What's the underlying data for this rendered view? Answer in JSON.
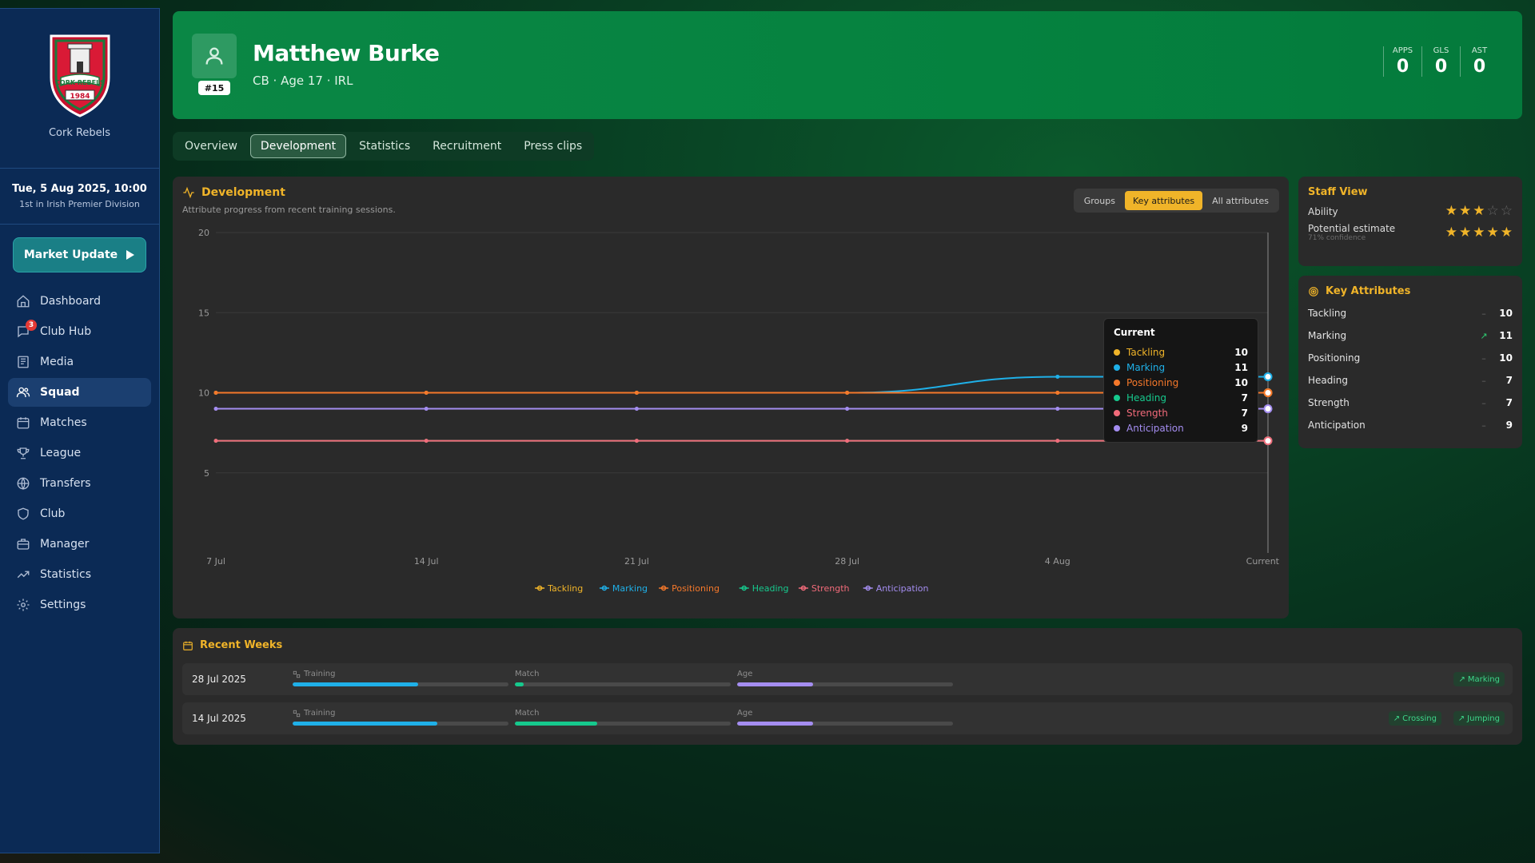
{
  "sidebar": {
    "club_name": "Cork Rebels",
    "crest_text": "CORK REBELS",
    "crest_year": "1984",
    "date": "Tue, 5 Aug 2025, 10:00",
    "league_position": "1st in Irish Premier Division",
    "market_button": "Market Update",
    "nav": [
      {
        "label": "Dashboard",
        "icon": "home-icon"
      },
      {
        "label": "Club Hub",
        "icon": "chat-icon",
        "badge": "3"
      },
      {
        "label": "Media",
        "icon": "newspaper-icon"
      },
      {
        "label": "Squad",
        "icon": "users-icon",
        "active": true
      },
      {
        "label": "Matches",
        "icon": "calendar-icon"
      },
      {
        "label": "League",
        "icon": "trophy-icon"
      },
      {
        "label": "Transfers",
        "icon": "globe-icon"
      },
      {
        "label": "Club",
        "icon": "shield-icon"
      },
      {
        "label": "Manager",
        "icon": "briefcase-icon"
      },
      {
        "label": "Statistics",
        "icon": "trend-icon"
      },
      {
        "label": "Settings",
        "icon": "gear-icon"
      }
    ]
  },
  "header": {
    "name": "Matthew Burke",
    "number": "#15",
    "meta": "CB · Age 17 · IRL",
    "stats": [
      {
        "label": "APPS",
        "value": "0"
      },
      {
        "label": "GLS",
        "value": "0"
      },
      {
        "label": "AST",
        "value": "0"
      }
    ]
  },
  "tabs": [
    "Overview",
    "Development",
    "Statistics",
    "Recruitment",
    "Press clips"
  ],
  "active_tab": "Development",
  "development": {
    "title": "Development",
    "subtitle": "Attribute progress from recent training sessions.",
    "toggle": [
      "Groups",
      "Key attributes",
      "All attributes"
    ],
    "toggle_active": "Key attributes",
    "tooltip": {
      "title": "Current",
      "rows": [
        {
          "name": "Tackling",
          "value": "10"
        },
        {
          "name": "Marking",
          "value": "11"
        },
        {
          "name": "Positioning",
          "value": "10"
        },
        {
          "name": "Heading",
          "value": "7"
        },
        {
          "name": "Strength",
          "value": "7"
        },
        {
          "name": "Anticipation",
          "value": "9"
        }
      ]
    }
  },
  "chart_data": {
    "type": "line",
    "categories": [
      "7 Jul",
      "14 Jul",
      "21 Jul",
      "28 Jul",
      "4 Aug",
      "Current"
    ],
    "ylim": [
      0,
      20
    ],
    "yticks": [
      5,
      10,
      15,
      20
    ],
    "grid": true,
    "legend": "bottom",
    "series": [
      {
        "name": "Tackling",
        "color": "#f0b429",
        "values": [
          10,
          10,
          10,
          10,
          10,
          10
        ]
      },
      {
        "name": "Marking",
        "color": "#1fb0e8",
        "values": [
          10,
          10,
          10,
          10,
          11,
          11
        ]
      },
      {
        "name": "Positioning",
        "color": "#f5782a",
        "values": [
          10,
          10,
          10,
          10,
          10,
          10
        ]
      },
      {
        "name": "Heading",
        "color": "#16c98d",
        "values": [
          7,
          7,
          7,
          7,
          7,
          7
        ]
      },
      {
        "name": "Strength",
        "color": "#f26b7a",
        "values": [
          7,
          7,
          7,
          7,
          7,
          7
        ]
      },
      {
        "name": "Anticipation",
        "color": "#a48df0",
        "values": [
          9,
          9,
          9,
          9,
          9,
          9
        ]
      }
    ]
  },
  "staff_view": {
    "title": "Staff View",
    "ability_label": "Ability",
    "ability_stars": 3,
    "potential_label": "Potential estimate",
    "potential_stars": 5,
    "confidence": "71% confidence"
  },
  "key_attributes": {
    "title": "Key Attributes",
    "rows": [
      {
        "name": "Tackling",
        "trend": "flat",
        "value": "10"
      },
      {
        "name": "Marking",
        "trend": "up",
        "value": "11"
      },
      {
        "name": "Positioning",
        "trend": "flat",
        "value": "10"
      },
      {
        "name": "Heading",
        "trend": "flat",
        "value": "7"
      },
      {
        "name": "Strength",
        "trend": "flat",
        "value": "7"
      },
      {
        "name": "Anticipation",
        "trend": "flat",
        "value": "9"
      }
    ]
  },
  "recent_weeks": {
    "title": "Recent Weeks",
    "labels": {
      "training": "Training",
      "match": "Match",
      "age": "Age"
    },
    "rows": [
      {
        "date": "28 Jul 2025",
        "training": 0.58,
        "match": 0.04,
        "age": 0.35,
        "chips": [
          "Marking"
        ]
      },
      {
        "date": "14 Jul 2025",
        "training": 0.67,
        "match": 0.38,
        "age": 0.35,
        "chips": [
          "Crossing",
          "Jumping"
        ]
      }
    ]
  },
  "colors": {
    "accent": "#f0b429",
    "training_bar": "#1fb0e8",
    "match_bar": "#16c98d",
    "age_bar": "#a48df0"
  }
}
